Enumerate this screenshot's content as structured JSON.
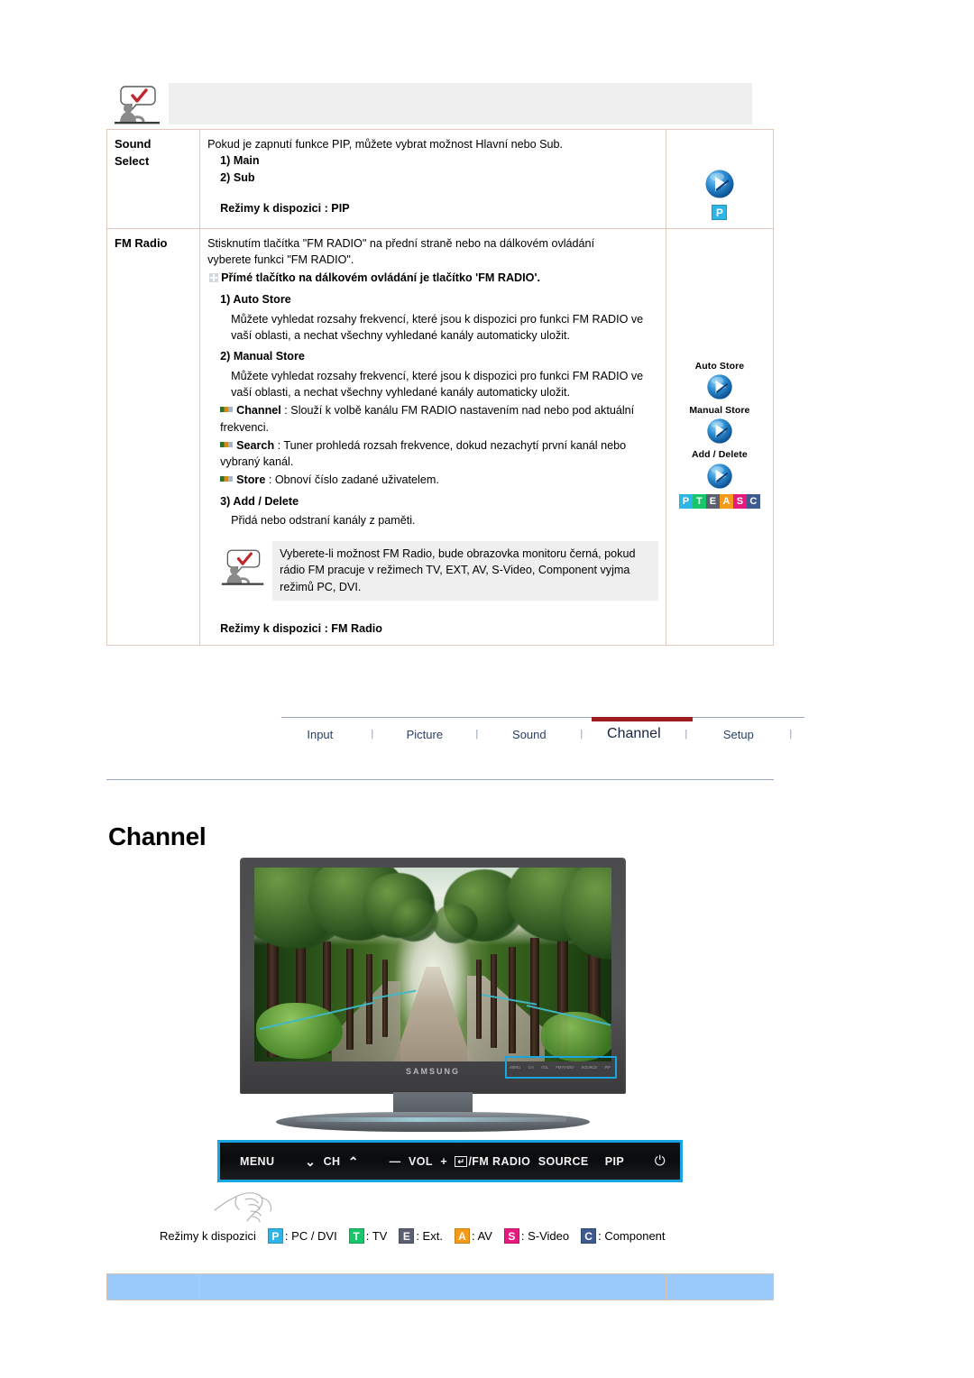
{
  "spec_table": {
    "rows": [
      {
        "label": "Sound\nSelect",
        "label_line1": "Sound",
        "label_line2": "Select",
        "intro": "Pokud je zapnutí funkce PIP, můžete vybrat možnost Hlavní nebo Sub.",
        "items": [
          "1) Main",
          "2) Sub"
        ],
        "modes": "Režimy k dispozici : PIP",
        "icon": {
          "name": "blue-play-sphere-icon",
          "badge": "P"
        }
      },
      {
        "label": "FM Radio",
        "intro_line1": "Stisknutím tlačítka \"FM RADIO\" na přední straně nebo na dálkovém ovládání",
        "intro_line2": "vyberete funkci \"FM RADIO\".",
        "plus_note": "Přímé tlačítko na dálkovém ovládání je tlačítko 'FM RADIO'.",
        "sections": [
          {
            "heading": "1) Auto Store",
            "body": "Můžete vyhledat rozsahy frekvencí, které jsou k dispozici pro funkci FM RADIO ve vaší oblasti, a nechat všechny vyhledané kanály automaticky uložit."
          },
          {
            "heading": "2) Manual Store",
            "body": "Můžete vyhledat rozsahy frekvencí, které jsou k dispozici pro funkci FM RADIO ve vaší oblasti, a nechat všechny vyhledané kanály automaticky uložit."
          }
        ],
        "dash_items": [
          {
            "term": "Channel",
            "desc": " : Slouží k volbě kanálu FM RADIO nastavením nad nebo pod aktuální frekvenci."
          },
          {
            "term": "Search",
            "desc": " : Tuner prohledá rozsah frekvence, dokud nezachytí první kanál nebo vybraný kanál."
          },
          {
            "term": "Store",
            "desc": " : Obnoví číslo zadané uživatelem."
          }
        ],
        "add_delete": {
          "heading": "3) Add / Delete",
          "body": "Přidá nebo odstraní kanály z paměti."
        },
        "inner_note": "Vyberete-li možnost FM Radio, bude obrazovka monitoru černá, pokud rádio FM pracuje v režimech TV, EXT, AV, S-Video, Component vyjma režimů PC, DVI.",
        "modes": "Režimy k dispozici : FM Radio",
        "icons": [
          {
            "label": "Auto Store",
            "name": "blue-play-sphere-icon"
          },
          {
            "label": "Manual Store",
            "name": "blue-play-sphere-icon"
          },
          {
            "label": "Add / Delete",
            "name": "blue-play-sphere-icon"
          }
        ],
        "pteasc": [
          "P",
          "T",
          "E",
          "A",
          "S",
          "C"
        ]
      }
    ]
  },
  "nav": {
    "items": [
      {
        "label": "Input",
        "active": false
      },
      {
        "label": "Picture",
        "active": false
      },
      {
        "label": "Sound",
        "active": false
      },
      {
        "label": "Channel",
        "active": true
      },
      {
        "label": "Setup",
        "active": false
      }
    ],
    "separator": "|",
    "active_bar_color": "#9e1b20"
  },
  "page_heading": "Channel",
  "monitor": {
    "brand": "SAMSUNG",
    "highlight_color": "#19a6e0",
    "mini_controls": [
      "MENU",
      "CH",
      "VOL",
      "FM RADIO",
      "SOURCE",
      "PIP"
    ]
  },
  "control_panel": {
    "items": [
      {
        "label": "MENU",
        "name": "menu-button"
      },
      {
        "label": "⌄",
        "name": "channel-down-button"
      },
      {
        "label": "CH",
        "name": "channel-label"
      },
      {
        "label": "⌃",
        "name": "channel-up-button"
      },
      {
        "label": "—",
        "name": "volume-down-button"
      },
      {
        "label": "VOL",
        "name": "volume-label"
      },
      {
        "label": "+",
        "name": "volume-up-button"
      },
      {
        "label": "/FM RADIO",
        "name": "enter-fm-radio-button",
        "prefix_key": "↵"
      },
      {
        "label": "SOURCE",
        "name": "source-button"
      },
      {
        "label": "PIP",
        "name": "pip-button"
      },
      {
        "label": "⏻",
        "name": "power-button"
      }
    ]
  },
  "legend": {
    "text": "Režimy k dispozici",
    "entries": [
      {
        "badge": "P",
        "label": ": PC / DVI",
        "color": "#2eb5e6"
      },
      {
        "badge": "T",
        "label": ": TV",
        "color": "#19c46a"
      },
      {
        "badge": "E",
        "label": ": Ext.",
        "color": "#5a6070"
      },
      {
        "badge": "A",
        "label": ": AV",
        "color": "#f59a18"
      },
      {
        "badge": "S",
        "label": ": S-Video",
        "color": "#e6197f"
      },
      {
        "badge": "C",
        "label": ": Component",
        "color": "#3e5a8e"
      }
    ]
  },
  "footer": {
    "cells": [
      "",
      "",
      ""
    ],
    "background": "#9ACAFC"
  }
}
